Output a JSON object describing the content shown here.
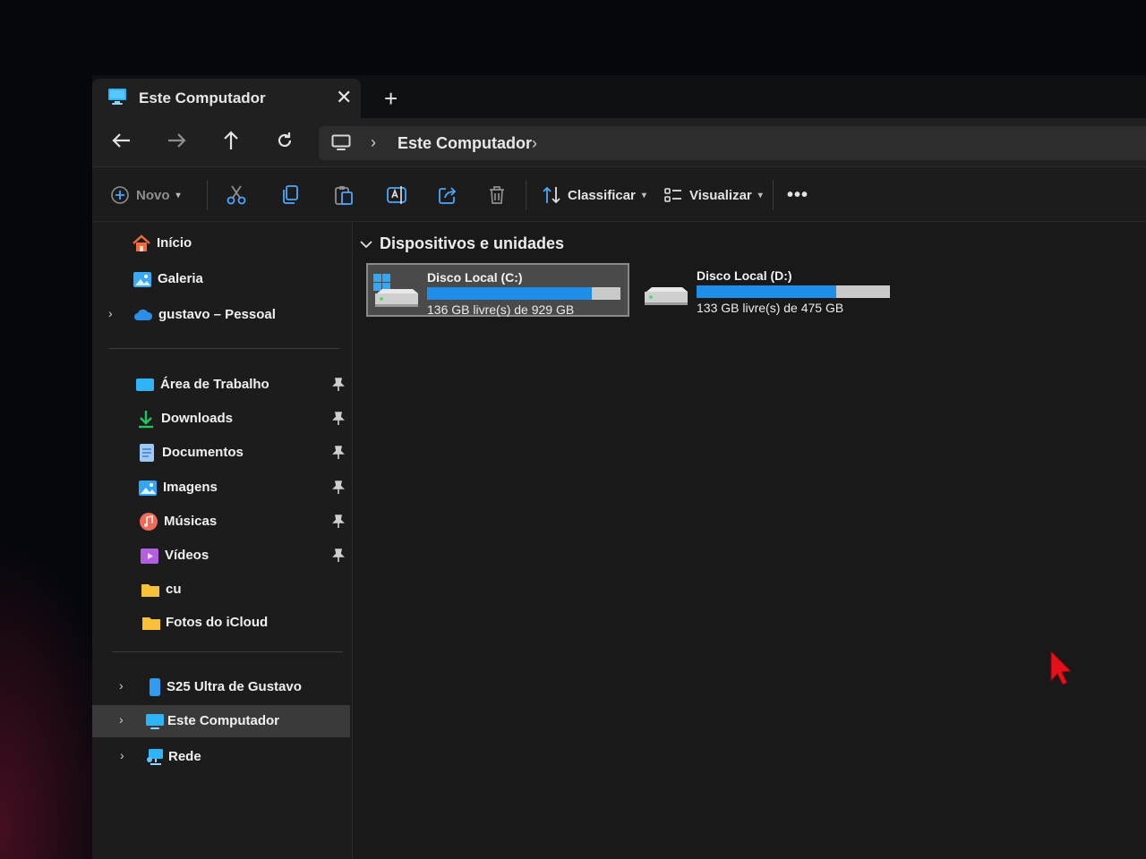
{
  "tab": {
    "title": "Este Computador",
    "icon": "computer-icon",
    "close_icon": "close-icon",
    "new_tab_icon": "plus-icon"
  },
  "nav": {
    "buttons": [
      "back-arrow-icon",
      "forward-arrow-icon",
      "up-arrow-icon",
      "refresh-icon"
    ],
    "address": {
      "icon": "computer-icon",
      "location": "Este Computador"
    }
  },
  "toolbar": {
    "new_label": "Novo",
    "icons": [
      "cut-icon",
      "copy-icon",
      "paste-icon",
      "rename-icon",
      "share-icon",
      "delete-icon"
    ],
    "sort_label": "Classificar",
    "view_label": "Visualizar",
    "more_icon": "more-icon"
  },
  "sidebar": {
    "top": [
      {
        "label": "Início",
        "icon": "home-icon"
      },
      {
        "label": "Galeria",
        "icon": "gallery-icon"
      },
      {
        "label": "gustavo – Pessoal",
        "icon": "cloud-icon",
        "expandable": true
      }
    ],
    "quick_access": [
      {
        "label": "Área de Trabalho",
        "icon": "desktop-icon",
        "pinned": true
      },
      {
        "label": "Downloads",
        "icon": "download-icon",
        "pinned": true
      },
      {
        "label": "Documentos",
        "icon": "document-icon",
        "pinned": true
      },
      {
        "label": "Imagens",
        "icon": "pictures-icon",
        "pinned": true
      },
      {
        "label": "Músicas",
        "icon": "music-icon",
        "pinned": true
      },
      {
        "label": "Vídeos",
        "icon": "videos-icon",
        "pinned": true
      },
      {
        "label": "cu",
        "icon": "folder-icon",
        "pinned": false
      },
      {
        "label": "Fotos do iCloud",
        "icon": "folder-icon",
        "pinned": false
      }
    ],
    "devices": [
      {
        "label": "S25 Ultra de Gustavo",
        "icon": "phone-icon",
        "expandable": true
      },
      {
        "label": "Este Computador",
        "icon": "computer-icon",
        "expandable": true,
        "selected": true
      },
      {
        "label": "Rede",
        "icon": "network-icon",
        "expandable": true
      }
    ]
  },
  "content": {
    "group_title": "Dispositivos e unidades",
    "drives": [
      {
        "name": "Disco Local (C:)",
        "free_text": "136 GB livre(s) de 929 GB",
        "used_fraction": 0.854,
        "selected": true,
        "icon": "windows-drive-icon"
      },
      {
        "name": "Disco Local (D:)",
        "free_text": "133 GB livre(s) de 475 GB",
        "used_fraction": 0.72,
        "selected": false,
        "icon": "drive-icon"
      }
    ]
  },
  "colors": {
    "accent": "#1f8ee9",
    "window_bg": "#191919",
    "selection": "#3a3a3a",
    "cursor": "#e5101a"
  }
}
